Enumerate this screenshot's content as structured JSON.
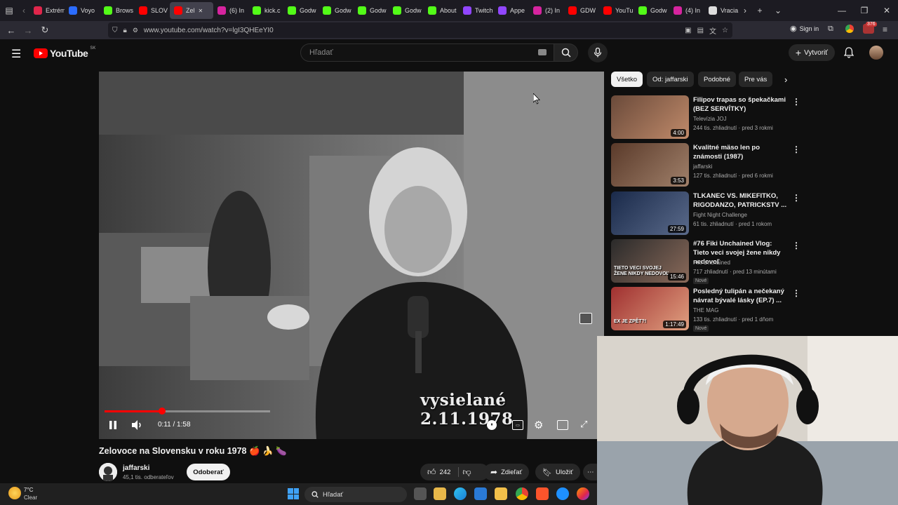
{
  "browser": {
    "tabs": [
      {
        "label": "Extrém",
        "icon": "opera-icon",
        "color": "#e0264b"
      },
      {
        "label": "Voyo",
        "icon": "voyo-icon",
        "color": "#2b6cff"
      },
      {
        "label": "Brows",
        "icon": "kick-icon",
        "color": "#53fc18"
      },
      {
        "label": "SLOV",
        "icon": "youtube-icon",
        "color": "#ff0000"
      },
      {
        "label": "Zel",
        "icon": "youtube-icon",
        "color": "#ff0000"
      },
      {
        "label": "(6) In",
        "icon": "instagram-icon",
        "color": "#d6249f"
      },
      {
        "label": "kick.c",
        "icon": "kick-icon",
        "color": "#53fc18"
      },
      {
        "label": "Godw",
        "icon": "kick-icon",
        "color": "#53fc18"
      },
      {
        "label": "Godw",
        "icon": "kick-icon",
        "color": "#53fc18"
      },
      {
        "label": "Godw",
        "icon": "kick-icon",
        "color": "#53fc18"
      },
      {
        "label": "Godw",
        "icon": "kick-icon",
        "color": "#53fc18"
      },
      {
        "label": "About",
        "icon": "kick-icon",
        "color": "#53fc18"
      },
      {
        "label": "Twitch",
        "icon": "twitch-icon",
        "color": "#9146ff"
      },
      {
        "label": "Appe",
        "icon": "twitch-icon",
        "color": "#9146ff"
      },
      {
        "label": "(2) In",
        "icon": "instagram-icon",
        "color": "#d6249f"
      },
      {
        "label": "GDW",
        "icon": "youtube-icon",
        "color": "#ff0000"
      },
      {
        "label": "YouTu",
        "icon": "youtube-icon",
        "color": "#ff0000"
      },
      {
        "label": "Godw",
        "icon": "kick-icon",
        "color": "#53fc18"
      },
      {
        "label": "(4) In",
        "icon": "instagram-icon",
        "color": "#d6249f"
      },
      {
        "label": "Vracia",
        "icon": "page-icon",
        "color": "#dddddd"
      }
    ],
    "url": "www.youtube.com/watch?v=lgI3QHEeYI0",
    "sign_in": "Sign in",
    "badge_count": "376"
  },
  "youtube": {
    "logo_text": "YouTube",
    "region": "SK",
    "search_placeholder": "Hľadať",
    "create_label": "Vytvoriť"
  },
  "player": {
    "time": "0:11 / 1:58",
    "progress_fraction": 0.093,
    "watermark": "vysielané 2.11.1978"
  },
  "video": {
    "title": "Zelovoce na Slovensku v roku 1978 🍎 🍌 🍆",
    "channel": "jaffarski",
    "subscribers": "45,1 tis. odberateľov",
    "subscribe_label": "Odoberať",
    "likes": "242",
    "share_label": "Zdieľať",
    "save_label": "Uložiť"
  },
  "chips": [
    "Všetko",
    "Od: jaffarski",
    "Podobné",
    "Pre vás"
  ],
  "recommendations": [
    {
      "title": "Filipov trapas so špekačkami (BEZ SERVÍTKY)",
      "channel": "Televízia JOJ",
      "meta": "244 tis. zhliadnutí · pred 3 rokmi",
      "duration": "4:00",
      "badge": ""
    },
    {
      "title": "Kvalitné mäso len po známosti (1987)",
      "channel": "jaffarski",
      "meta": "127 tis. zhliadnutí · pred 6 rokmi",
      "duration": "3:53",
      "badge": ""
    },
    {
      "title": "TLKANEC VS. MIKEFITKO, RIGODANZO, PATRICKSTV ...",
      "channel": "Fight Night Challenge",
      "meta": "61 tis. zhliadnutí · pred 1 rokom",
      "duration": "27:59",
      "badge": ""
    },
    {
      "title": "#76 Fiki Unchained Vlog: Tieto veci svojej žene nikdy nedovoľ",
      "channel": "Fiki Unchained",
      "meta": "717 zhliadnutí · pred 13 minútami",
      "duration": "15:46",
      "badge": "Nové",
      "thumb_text": "TIETO VECI SVOJEJ ŽENE NIKDY NEDOVOĽ"
    },
    {
      "title": "Posledný tulipán a nečekaný návrat bývalé lásky (EP.7) ...",
      "channel": "THE MAG",
      "meta": "133 tis. zhliadnutí · pred 1 dňom",
      "duration": "1:17:49",
      "badge": "Nové",
      "thumb_text": "EX JE ZPĚT?!"
    }
  ],
  "taskbar": {
    "weather_temp": "7°C",
    "weather_desc": "Clear",
    "search_placeholder": "Hľadať"
  }
}
